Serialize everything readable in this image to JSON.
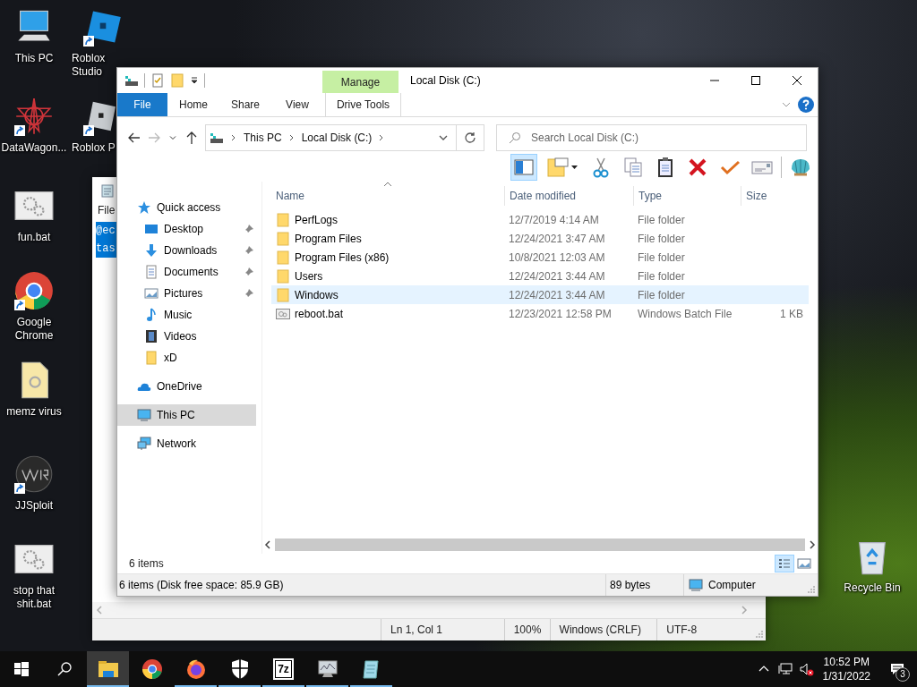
{
  "desktop_icons": [
    {
      "label": "This PC",
      "kind": "pc",
      "shortcut": false
    },
    {
      "label": "Roblox Studio",
      "kind": "roblox-studio",
      "shortcut": true
    },
    {
      "label": "DataWagon...",
      "kind": "star-web",
      "shortcut": true
    },
    {
      "label": "Roblox P",
      "kind": "roblox-player",
      "shortcut": true
    },
    {
      "label": "fun.bat",
      "kind": "bat",
      "shortcut": false
    },
    {
      "label": "Google Chrome",
      "kind": "chrome",
      "shortcut": true
    },
    {
      "label": "memz virus",
      "kind": "document",
      "shortcut": false
    },
    {
      "label": "JJSploit",
      "kind": "dark-logo",
      "shortcut": true
    },
    {
      "label": "stop that shit.bat",
      "kind": "bat",
      "shortcut": false
    },
    {
      "label": "Recycle Bin",
      "kind": "recycle",
      "shortcut": false
    }
  ],
  "notepad": {
    "menu": [
      "File"
    ],
    "selected_lines": [
      "@ec",
      "tas"
    ],
    "status": [
      "Ln 1, Col 1",
      "100%",
      "Windows (CRLF)",
      "UTF-8"
    ]
  },
  "explorer": {
    "title": "Local Disk (C:)",
    "context_group": "Manage",
    "ribbon_tabs": [
      {
        "label": "File",
        "kind": "file"
      },
      {
        "label": "Home",
        "kind": "tab"
      },
      {
        "label": "Share",
        "kind": "tab"
      },
      {
        "label": "View",
        "kind": "tab"
      },
      {
        "label": "Drive Tools",
        "kind": "context"
      }
    ],
    "nav_buttons": [
      {
        "kind": "back",
        "disabled": false
      },
      {
        "kind": "forward",
        "disabled": true
      },
      {
        "kind": "recent",
        "disabled": false
      },
      {
        "kind": "up",
        "disabled": false
      }
    ],
    "breadcrumb": [
      "This PC",
      "Local Disk (C:)"
    ],
    "search": {
      "placeholder": "Search Local Disk (C:)"
    },
    "toolbar": [
      {
        "kind": "pane",
        "selected": true
      },
      {
        "kind": "new-folder",
        "selected": false
      },
      {
        "kind": "cut",
        "selected": false
      },
      {
        "kind": "copy",
        "selected": false
      },
      {
        "kind": "paste",
        "selected": false
      },
      {
        "kind": "delete",
        "selected": false
      },
      {
        "kind": "check",
        "selected": false
      },
      {
        "kind": "card",
        "selected": false
      },
      {
        "kind": "shell",
        "selected": false
      }
    ],
    "nav": [
      {
        "label": "Quick access",
        "kind": "quick",
        "selected": false,
        "children": [
          {
            "label": "Desktop",
            "kind": "desktop",
            "pinned": true,
            "selected": false
          },
          {
            "label": "Downloads",
            "kind": "downloads",
            "pinned": true,
            "selected": false
          },
          {
            "label": "Documents",
            "kind": "documents",
            "pinned": true,
            "selected": false
          },
          {
            "label": "Pictures",
            "kind": "pictures",
            "pinned": true,
            "selected": false
          },
          {
            "label": "Music",
            "kind": "music",
            "pinned": false,
            "selected": false
          },
          {
            "label": "Videos",
            "kind": "videos",
            "pinned": false,
            "selected": false
          },
          {
            "label": "xD",
            "kind": "folder",
            "pinned": false,
            "selected": false
          }
        ]
      },
      {
        "label": "OneDrive",
        "kind": "cloud",
        "selected": false
      },
      {
        "label": "This PC",
        "kind": "pc",
        "selected": true
      },
      {
        "label": "Network",
        "kind": "network",
        "selected": false
      }
    ],
    "columns": [
      "Name",
      "Date modified",
      "Type",
      "Size"
    ],
    "rows": [
      {
        "name": "PerfLogs",
        "kind": "folder",
        "date": "12/7/2019 4:14 AM",
        "type": "File folder",
        "selected": false
      },
      {
        "name": "Program Files",
        "kind": "folder",
        "date": "12/24/2021 3:47 AM",
        "type": "File folder",
        "selected": false
      },
      {
        "name": "Program Files (x86)",
        "kind": "folder",
        "date": "10/8/2021 12:03 AM",
        "type": "File folder",
        "selected": false
      },
      {
        "name": "Users",
        "kind": "folder",
        "date": "12/24/2021 3:44 AM",
        "type": "File folder",
        "selected": false
      },
      {
        "name": "Windows",
        "kind": "folder",
        "date": "12/24/2021 3:44 AM",
        "type": "File folder",
        "selected": true
      },
      {
        "name": "reboot.bat",
        "kind": "bat",
        "date": "12/23/2021 12:58 PM",
        "type": "Windows Batch File",
        "size": "1 KB",
        "selected": false
      }
    ],
    "item_count": "6 items",
    "view_buttons": [
      {
        "kind": "details",
        "selected": true
      },
      {
        "kind": "large-icons",
        "selected": false
      }
    ],
    "status": [
      "6 items (Disk free space: 85.9 GB)",
      "89 bytes",
      "Computer"
    ]
  },
  "taskbar": {
    "apps": [
      {
        "kind": "explorer",
        "running": true,
        "selected": true
      },
      {
        "kind": "chrome",
        "running": false,
        "selected": false
      },
      {
        "kind": "firefox",
        "running": true,
        "selected": false
      },
      {
        "kind": "shield",
        "running": true,
        "selected": false
      },
      {
        "kind": "archiver",
        "label": "7z",
        "running": true,
        "selected": false
      },
      {
        "kind": "monitor",
        "running": true,
        "selected": false
      },
      {
        "kind": "notepad",
        "running": true,
        "selected": false
      }
    ],
    "time": "10:52 PM",
    "date": "1/31/2022",
    "notifications": "3"
  }
}
